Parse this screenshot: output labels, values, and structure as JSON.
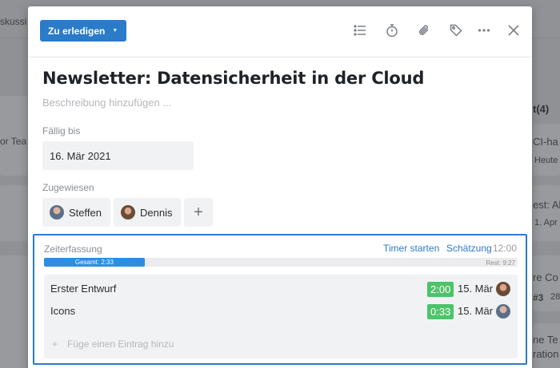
{
  "background": {
    "left_texts": [
      "skussi",
      "or Tea"
    ],
    "right_texts": [
      "t(4)",
      "CI-ha",
      "Heute",
      "est: Al",
      "1. Apr",
      "re Co",
      "#3",
      "28",
      "ne Te",
      "ration"
    ]
  },
  "header": {
    "status_label": "Zu erledigen",
    "icons": [
      "list-icon",
      "timer-icon",
      "paperclip-icon",
      "tag-icon",
      "more-icon",
      "close-icon"
    ]
  },
  "task": {
    "title": "Newsletter: Datensicherheit in der Cloud",
    "description_placeholder": "Beschreibung hinzufügen ...",
    "due_label": "Fällig bis",
    "due_date": "16. Mär 2021",
    "assigned_label": "Zugewiesen",
    "assignees": [
      {
        "name": "Steffen"
      },
      {
        "name": "Dennis"
      }
    ],
    "add_assignee": "+"
  },
  "time_tracking": {
    "label": "Zeiterfassung",
    "start_timer": "Timer starten",
    "estimate": "Schätzung",
    "estimate_value": "12:00",
    "total_label": "Gesamt: 2:33",
    "rest_label": "Rest: 9:27",
    "progress": 0.2125,
    "entries": [
      {
        "name": "Erster Entwurf",
        "duration": "2:00",
        "date": "15. Mär"
      },
      {
        "name": "Icons",
        "duration": "0:33",
        "date": "15. Mär"
      }
    ],
    "add_entry_icon": "+",
    "add_entry_placeholder": "Füge einen Eintrag hinzu"
  },
  "colors": {
    "accent": "#2b7bc8",
    "duration_badge": "#4cc46a"
  }
}
